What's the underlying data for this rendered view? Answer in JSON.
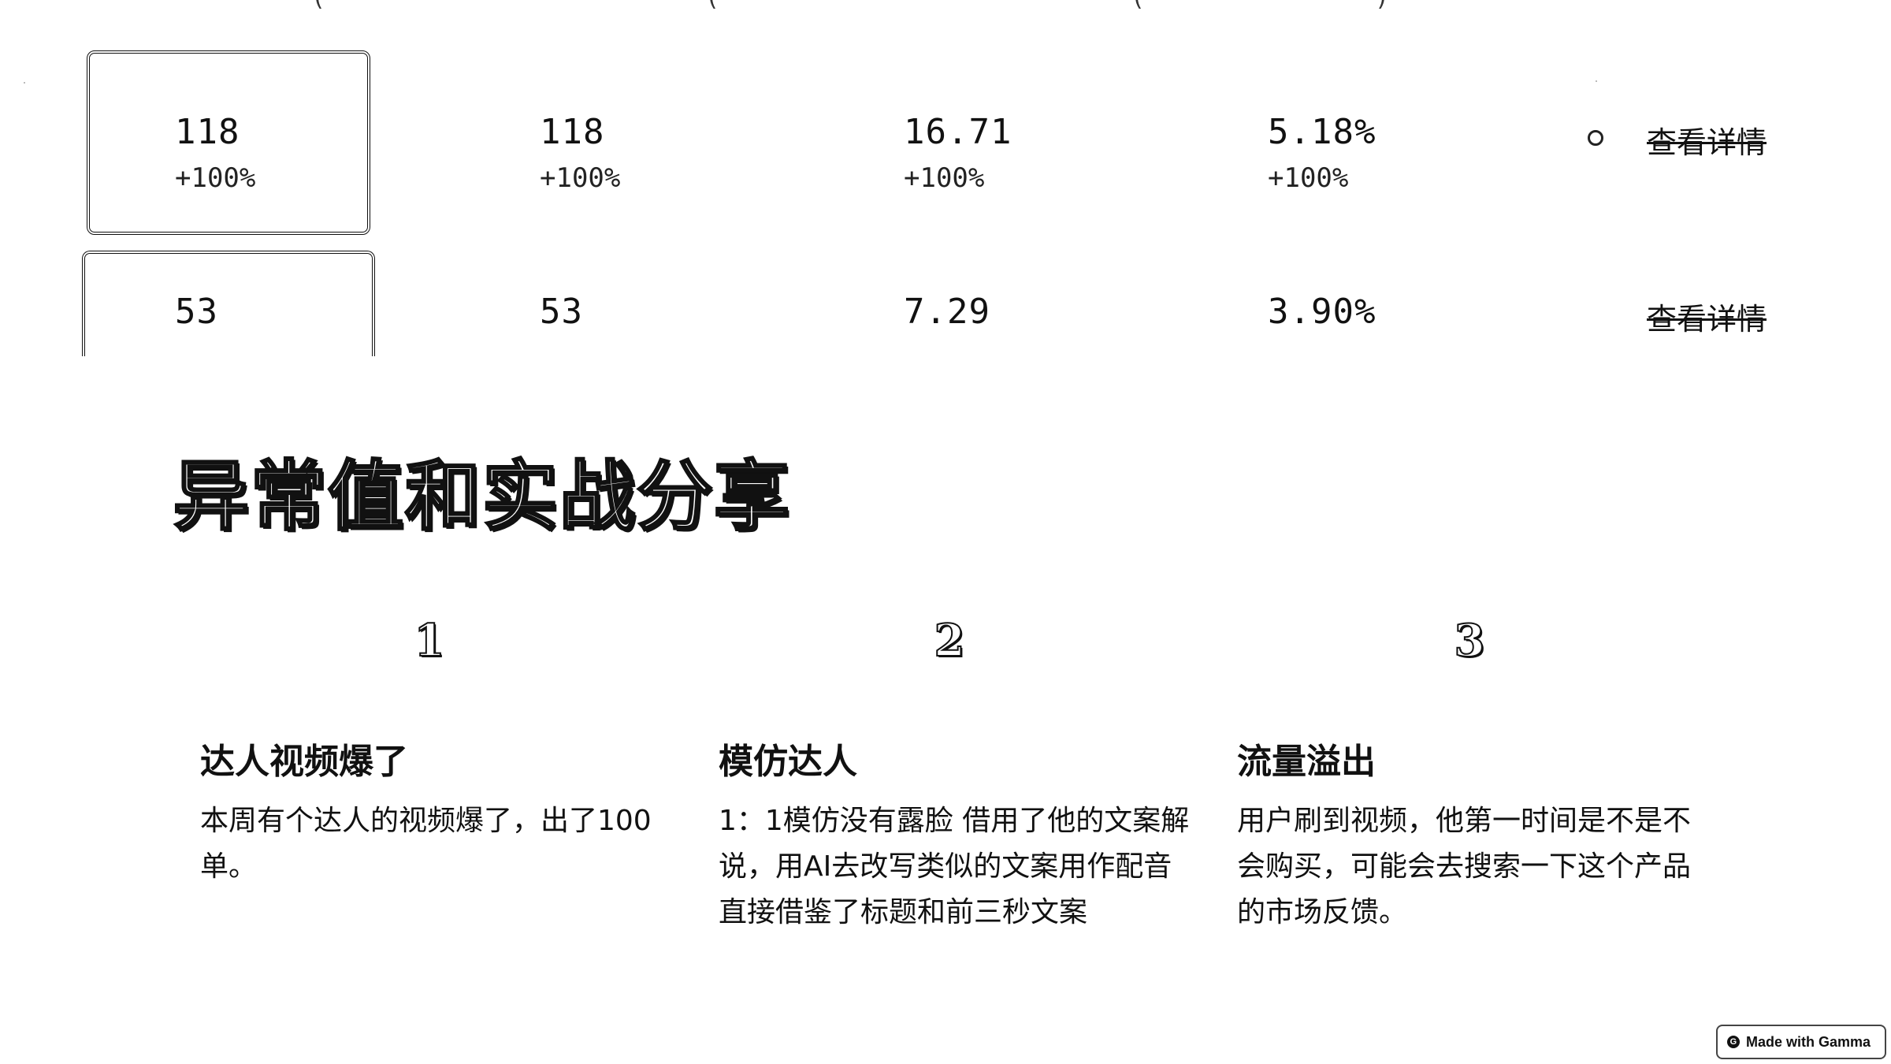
{
  "table": {
    "rows": [
      {
        "cells": [
          {
            "value": "118",
            "change": "+100%"
          },
          {
            "value": "118",
            "change": "+100%"
          },
          {
            "value": "16.71",
            "change": "+100%"
          },
          {
            "value": "5.18%",
            "change": "+100%"
          }
        ],
        "action_label": "查看详情"
      },
      {
        "cells": [
          {
            "value": "53",
            "change": ""
          },
          {
            "value": "53",
            "change": ""
          },
          {
            "value": "7.29",
            "change": ""
          },
          {
            "value": "3.90%",
            "change": ""
          }
        ],
        "action_label": "查看详情"
      }
    ]
  },
  "section": {
    "title": "异常值和实战分享"
  },
  "cards": [
    {
      "number": "1",
      "title": "达人视频爆了",
      "body": "本周有个达人的视频爆了，出了100单。"
    },
    {
      "number": "2",
      "title": "模仿达人",
      "body": "1：1模仿没有露脸 借用了他的文案解说，用AI去改写类似的文案用作配音直接借鉴了标题和前三秒文案"
    },
    {
      "number": "3",
      "title": "流量溢出",
      "body": "用户刷到视频，他第一时间是不是不会购买，可能会去搜索一下这个产品的市场反馈。"
    }
  ],
  "footer": {
    "badge_label": "Made with Gamma",
    "badge_icon": "gamma-logo-icon"
  }
}
